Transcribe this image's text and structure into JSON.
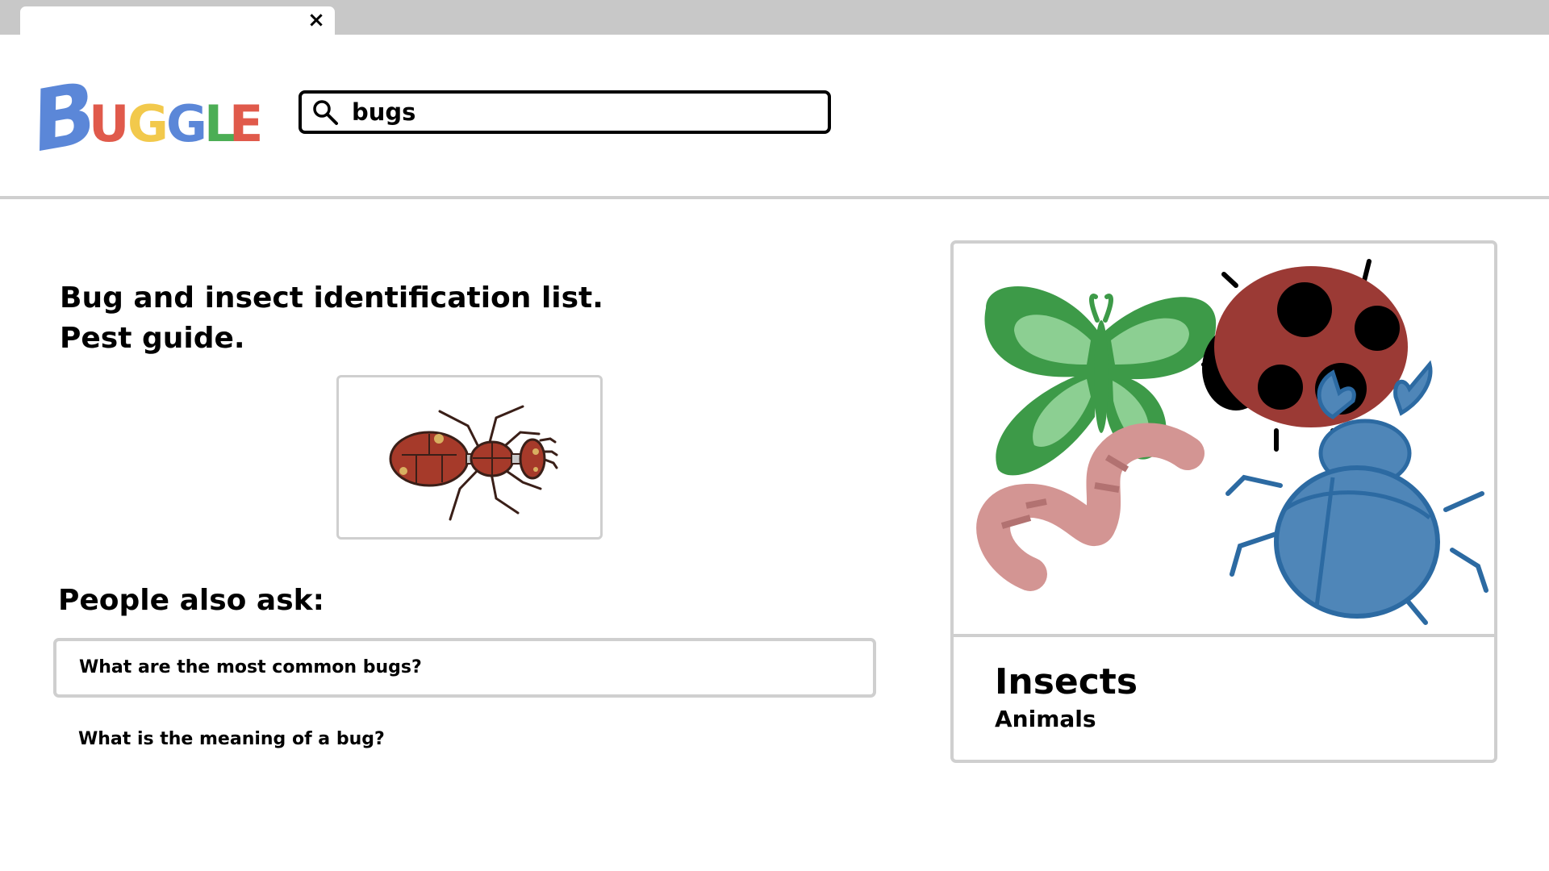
{
  "browser": {
    "tab_close_symbol": "×"
  },
  "logo": {
    "letters": [
      {
        "char": "B",
        "color": "#5b87d8"
      },
      {
        "char": "U",
        "color": "#e05a4b"
      },
      {
        "char": "G",
        "color": "#f2c94c"
      },
      {
        "char": "G",
        "color": "#5b87d8"
      },
      {
        "char": "L",
        "color": "#4cae55"
      },
      {
        "char": "E",
        "color": "#e05a4b"
      }
    ]
  },
  "search": {
    "value": "bugs",
    "icon": "search-icon"
  },
  "result": {
    "title_line1": "Bug and insect identification list.",
    "title_line2": "Pest guide.",
    "image_icon": "ant-illustration"
  },
  "people_also_ask": {
    "heading": "People also ask:",
    "questions": [
      "What are the most common bugs?",
      "What is the meaning of a bug?"
    ]
  },
  "knowledge_panel": {
    "title": "Insects",
    "subtitle": "Animals",
    "image_icons": [
      "butterfly-icon",
      "ladybug-icon",
      "worm-icon",
      "beetle-icon"
    ]
  },
  "colors": {
    "border": "#cfcfcf",
    "tabbar": "#c8c8c8",
    "butterfly": "#3d9a48",
    "ladybug": "#9b3a35",
    "worm": "#d39593",
    "beetle": "#4f86b8",
    "ant": "#a63a2a"
  }
}
